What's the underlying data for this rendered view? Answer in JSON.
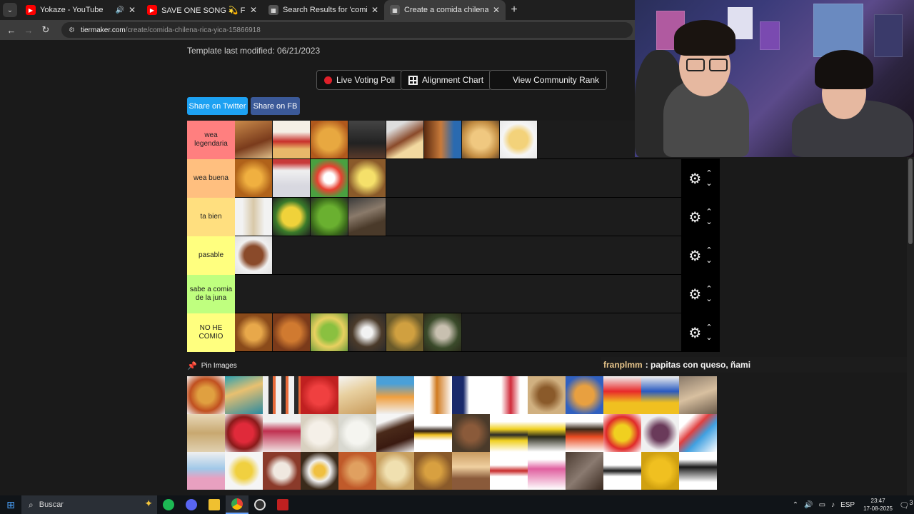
{
  "browser": {
    "tabs": [
      {
        "title": "Yokaze - YouTube",
        "favicon": "youtube-icon",
        "color": "#ff0000",
        "active": false,
        "audio": true
      },
      {
        "title": "SAVE ONE SONG 💫 From A to Z",
        "favicon": "youtube-icon",
        "color": "#ff0000",
        "active": false,
        "audio": false
      },
      {
        "title": "Search Results for 'comida chilena'",
        "favicon": "tiermaker-icon",
        "color": "#444444",
        "active": false,
        "audio": false
      },
      {
        "title": "Create a comida chilena rica yica",
        "favicon": "tiermaker-icon",
        "color": "#444444",
        "active": true,
        "audio": false
      }
    ],
    "url_host": "tiermaker.com",
    "url_path": "/create/comida-chilena-rica-yica-15866918"
  },
  "page": {
    "template_modified": "Template last modified: 06/21/2023",
    "buttons": {
      "live_voting": "Live Voting Poll",
      "alignment": "Alignment Chart",
      "community": "View Community Rank"
    },
    "share_twitter": "Share on Twitter",
    "share_fb": "Share on FB",
    "tiers": [
      {
        "label": "wea legendaria",
        "color": "#ff7f7f",
        "items": 8,
        "controls": false
      },
      {
        "label": "wea buena",
        "color": "#ffbf7f",
        "items": 4,
        "controls": true
      },
      {
        "label": "ta bien",
        "color": "#ffdf7f",
        "items": 4,
        "controls": true
      },
      {
        "label": "pasable",
        "color": "#ffff7f",
        "items": 1,
        "controls": true
      },
      {
        "label": "sabe a comia de la juna",
        "color": "#bfff7f",
        "items": 0,
        "controls": true
      },
      {
        "label": "NO HE COMIO",
        "color": "#ffff7f",
        "items": 6,
        "controls": true
      }
    ],
    "pin_images": "Pin Images"
  },
  "chat": {
    "user": "franplmm",
    "message": ": papitas con queso, ñami"
  },
  "taskbar": {
    "search_placeholder": "Buscar",
    "lang": "ESP",
    "time": "23:47",
    "date": "17-08-2025",
    "notifications": "3"
  }
}
